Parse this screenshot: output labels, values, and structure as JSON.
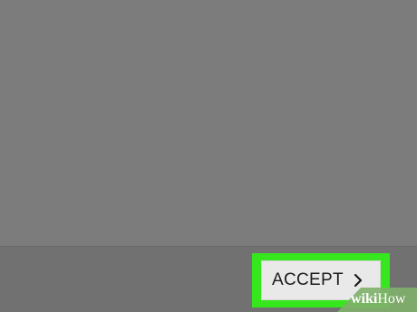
{
  "screen": {
    "background_color": "#7c7c7c",
    "bottom_bar_color": "#717171"
  },
  "accept_button": {
    "label": "ACCEPT",
    "icon": "chevron-right-icon",
    "highlight_color": "#35e71c"
  },
  "watermark": {
    "brand_bold": "wiki",
    "brand_regular": "How"
  }
}
